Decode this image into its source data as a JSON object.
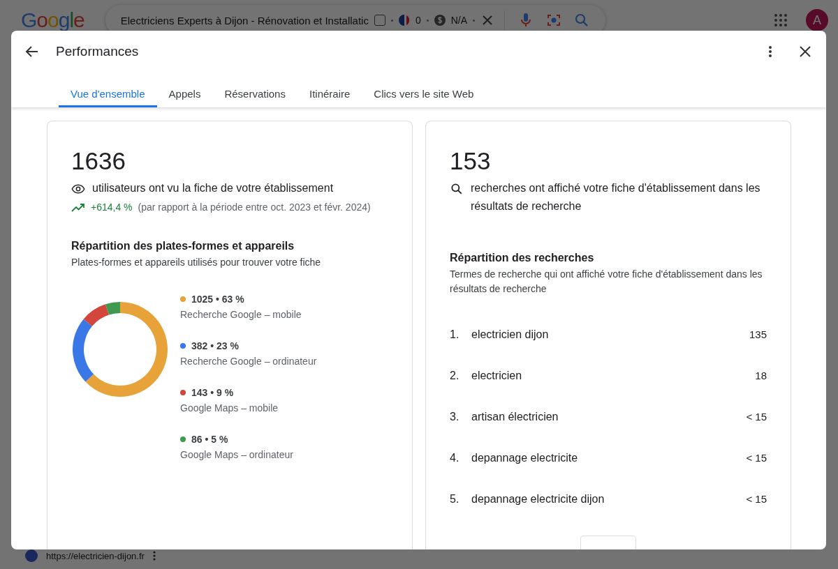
{
  "browser": {
    "logo": "Google",
    "search_query": "Electriciens Experts à Dijon - Rénovation et Installatic",
    "checkbox_checked": false,
    "flag_count": "0",
    "price": "N/A",
    "avatar": "A"
  },
  "background_page": {
    "url": "https://electricien-dijon.fr"
  },
  "dialog": {
    "title": "Performances",
    "tabs": [
      {
        "label": "Vue d'ensemble",
        "selected": true
      },
      {
        "label": "Appels",
        "selected": false
      },
      {
        "label": "Réservations",
        "selected": false
      },
      {
        "label": "Itinéraire",
        "selected": false
      },
      {
        "label": "Clics vers le site Web",
        "selected": false
      }
    ]
  },
  "views_card": {
    "value": "1636",
    "description": "utilisateurs ont vu la fiche de votre établissement",
    "change": "+614,4 %",
    "comparison": "(par rapport à la période entre oct. 2023 et févr. 2024)",
    "section_title": "Répartition des plates-formes et appareils",
    "section_subtitle": "Plates-formes et appareils utilisés pour trouver votre fiche",
    "chart_data": {
      "type": "donut",
      "categories": [
        "Recherche Google – mobile",
        "Recherche Google – ordinateur",
        "Google Maps – mobile",
        "Google Maps – ordinateur"
      ],
      "values": [
        63,
        23,
        9,
        5
      ]
    },
    "legend": [
      {
        "color": "#e8a23a",
        "value": "1025 • 63 %"
      },
      {
        "color": "#3b78e7",
        "value": "382 • 23 %"
      },
      {
        "color": "#d2463b",
        "value": "143 • 9 %"
      },
      {
        "color": "#3f9a4f",
        "value": "86 • 5 %"
      }
    ]
  },
  "searches_card": {
    "value": "153",
    "description": "recherches ont affiché votre fiche d'établissement dans les résultats de recherche",
    "section_title": "Répartition des recherches",
    "section_subtitle": "Termes de recherche qui ont affiché votre fiche d'établissement dans les résultats de recherche",
    "terms": [
      {
        "rank": "1.",
        "term": "electricien dijon",
        "count": "135"
      },
      {
        "rank": "2.",
        "term": "electricien",
        "count": "18"
      },
      {
        "rank": "3.",
        "term": "artisan électricien",
        "count": "< 15"
      },
      {
        "rank": "4.",
        "term": "depannage electricite",
        "count": "< 15"
      },
      {
        "rank": "5.",
        "term": "depannage electricite dijon",
        "count": "< 15"
      }
    ]
  }
}
